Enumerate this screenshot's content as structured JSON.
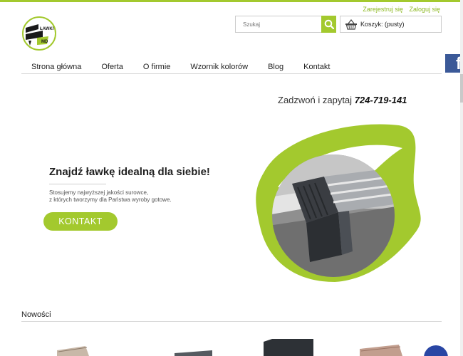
{
  "colors": {
    "accent": "#a3c92e",
    "facebook": "#3b5998",
    "chat": "#2946a4"
  },
  "header": {
    "register_label": "Zarejestruj się",
    "login_label": "Zaloguj się",
    "logo_icon": "lawki-logo-icon",
    "search": {
      "placeholder": "Szukaj",
      "icon": "search-icon"
    },
    "cart": {
      "label": "Koszyk: (pusty)",
      "icon": "basket-icon"
    }
  },
  "facebook": {
    "glyph": "f",
    "icon": "facebook-icon"
  },
  "nav": {
    "items": [
      {
        "label": "Strona główna"
      },
      {
        "label": "Oferta"
      },
      {
        "label": "O firmie"
      },
      {
        "label": "Wzornik kolorów"
      },
      {
        "label": "Blog"
      },
      {
        "label": "Kontakt"
      }
    ]
  },
  "phone": {
    "prefix": "Zadzwoń i zapytaj",
    "number": "724-719-141"
  },
  "hero": {
    "title": "Znajdź ławkę idealną dla siebie!",
    "text_line1": "Stosujemy najwyższej jakości surowce,",
    "text_line2": "z których tworzymy dla Państwa wyroby gotowe.",
    "button_label": "KONTAKT",
    "image_icon": "bench-photo"
  },
  "news": {
    "title": "Nowości"
  },
  "chat": {
    "icon": "chat-icon"
  }
}
